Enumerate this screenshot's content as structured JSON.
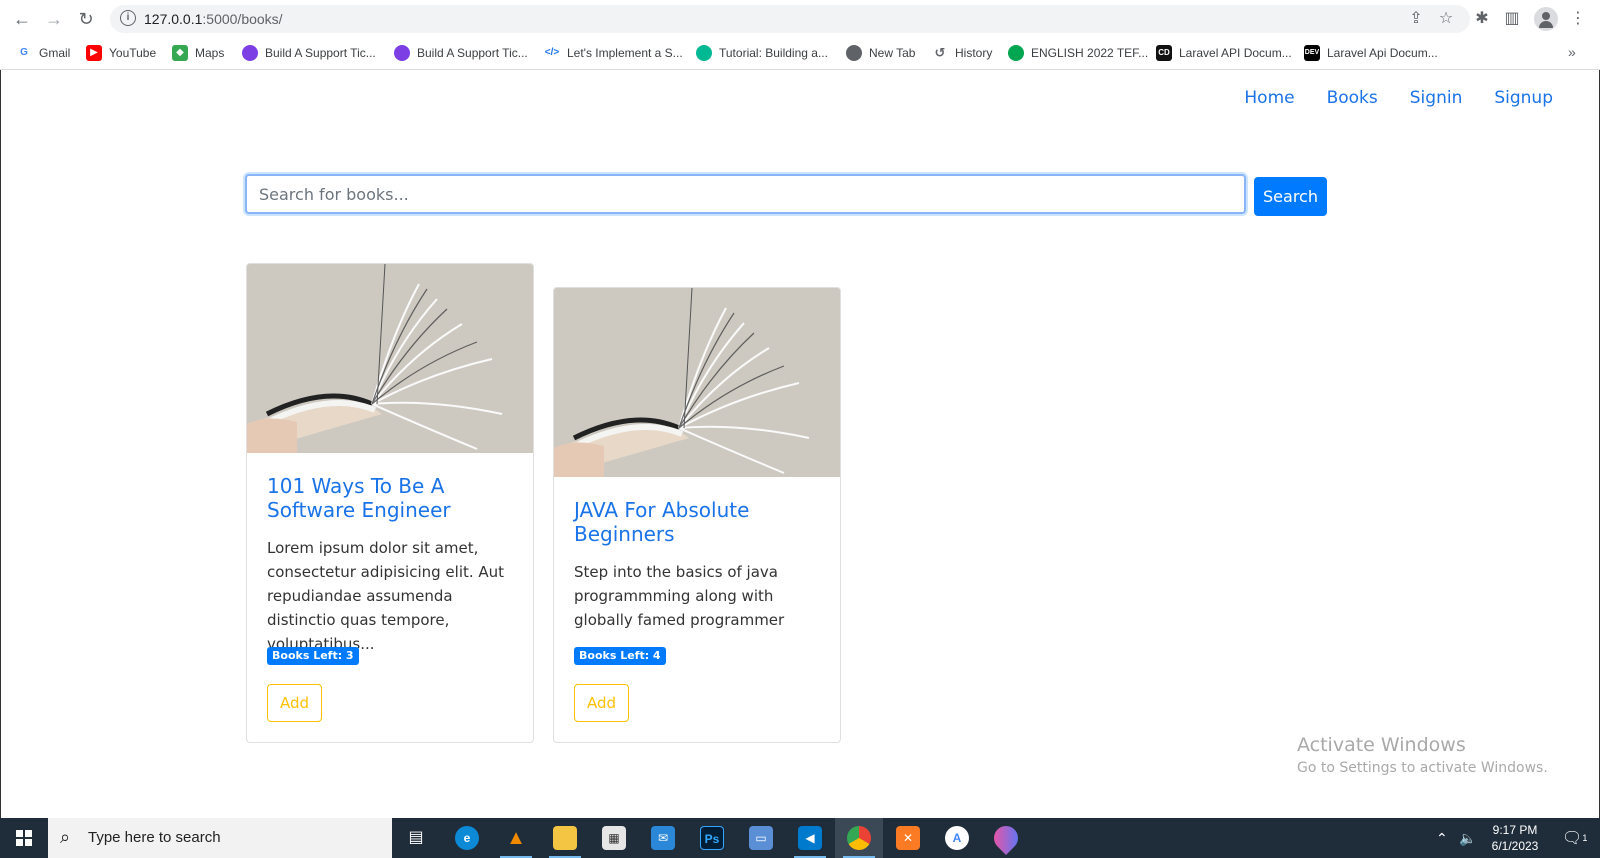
{
  "browser": {
    "url_host": "127.0.0.1",
    "url_path": ":5000/books/",
    "bookmarks": [
      {
        "label": "Gmail",
        "icon": "google-icon",
        "color": "#ea4335"
      },
      {
        "label": "YouTube",
        "icon": "youtube-icon",
        "color": "#ff0000"
      },
      {
        "label": "Maps",
        "icon": "maps-icon",
        "color": "#34a853"
      },
      {
        "label": "Build A Support Tic...",
        "icon": "support-icon",
        "color": "#7b3fe4"
      },
      {
        "label": "Build A Support Tic...",
        "icon": "support-icon",
        "color": "#7b3fe4"
      },
      {
        "label": "Let's Implement a S...",
        "icon": "code-icon",
        "color": "#1a73e8"
      },
      {
        "label": "Tutorial: Building a...",
        "icon": "tutorial-icon",
        "color": "#00b894"
      },
      {
        "label": "New Tab",
        "icon": "globe-icon",
        "color": "#5f6368"
      },
      {
        "label": "History",
        "icon": "history-icon",
        "color": "#5f6368"
      },
      {
        "label": "ENGLISH 2022 TEF...",
        "icon": "english-icon",
        "color": "#00a651"
      },
      {
        "label": "Laravel API Docum...",
        "icon": "cd-icon",
        "color": "#111111"
      },
      {
        "label": "Laravel Api Docum...",
        "icon": "dev-icon",
        "color": "#000000"
      }
    ]
  },
  "nav": {
    "home": "Home",
    "books": "Books",
    "signin": "Signin",
    "signup": "Signup"
  },
  "search": {
    "placeholder": "Search for books...",
    "button": "Search"
  },
  "books": [
    {
      "title": "101 Ways To Be A Software Engineer",
      "description": "Lorem ipsum dolor sit amet, consectetur adipisicing elit. Aut repudiandae assumenda distinctio quas tempore, voluptatibus...",
      "badge": "Books Left: 3",
      "add": "Add"
    },
    {
      "title": "JAVA For Absolute Beginners",
      "description": "Step into the basics of java programmming along with globally famed programmer",
      "badge": "Books Left: 4",
      "add": "Add"
    }
  ],
  "watermark": {
    "line1": "Activate Windows",
    "line2": "Go to Settings to activate Windows."
  },
  "taskbar": {
    "search_placeholder": "Type here to search",
    "time": "9:17 PM",
    "date": "6/1/2023",
    "notification_count": "1"
  },
  "colors": {
    "primary": "#007bff",
    "link": "#1a73e8",
    "warning": "#ffc107"
  }
}
